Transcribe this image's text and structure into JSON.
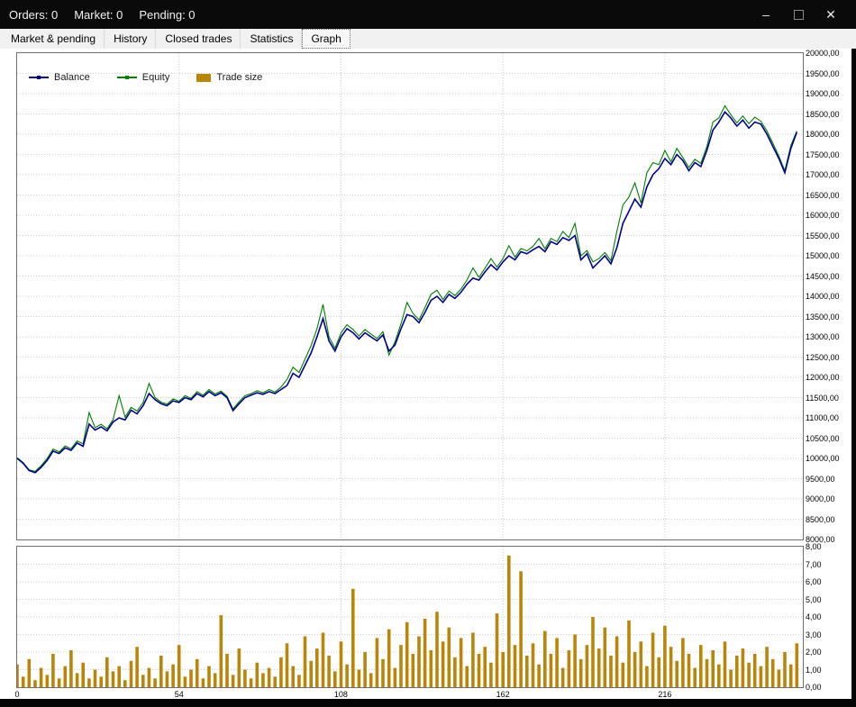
{
  "titlebar": {
    "orders": "Orders: 0",
    "market": "Market: 0",
    "pending": "Pending: 0",
    "minimize_glyph": "–",
    "close_glyph": "✕"
  },
  "tabs": [
    {
      "label": "Market & pending",
      "active": false
    },
    {
      "label": "History",
      "active": false
    },
    {
      "label": "Closed trades",
      "active": false
    },
    {
      "label": "Statistics",
      "active": false
    },
    {
      "label": "Graph",
      "active": true
    }
  ],
  "legend": [
    {
      "label": "Balance",
      "type": "line",
      "color": "#00008b"
    },
    {
      "label": "Equity",
      "type": "line",
      "color": "#008000"
    },
    {
      "label": "Trade size",
      "type": "swatch",
      "color": "#b8860b"
    }
  ],
  "chart_data": [
    {
      "type": "line",
      "ylim": [
        8000,
        20000
      ],
      "ytick_step": 500,
      "xlim": [
        0,
        262
      ],
      "xticks": [
        0,
        54,
        108,
        162,
        216
      ],
      "x_start": 0,
      "x_step": 2,
      "grid": true,
      "legend_position": "top-left",
      "decimal_separator": ",",
      "series": [
        {
          "name": "Balance",
          "color": "#00008b",
          "values": [
            10000,
            9880,
            9700,
            9650,
            9780,
            9950,
            10180,
            10120,
            10260,
            10200,
            10380,
            10300,
            10850,
            10700,
            10780,
            10680,
            10900,
            11000,
            10950,
            11190,
            11100,
            11300,
            11600,
            11450,
            11350,
            11300,
            11420,
            11380,
            11500,
            11450,
            11600,
            11520,
            11650,
            11550,
            11620,
            11500,
            11180,
            11350,
            11500,
            11560,
            11620,
            11580,
            11650,
            11600,
            11700,
            11800,
            12100,
            12000,
            12300,
            12600,
            13000,
            13450,
            12900,
            12650,
            13000,
            13200,
            13100,
            12950,
            13100,
            13000,
            12900,
            13050,
            12650,
            12800,
            13200,
            13550,
            13500,
            13350,
            13600,
            13900,
            14000,
            13850,
            14050,
            13950,
            14100,
            14300,
            14450,
            14400,
            14600,
            14780,
            14650,
            14850,
            15000,
            14900,
            15100,
            15050,
            15150,
            15230,
            15100,
            15350,
            15280,
            15450,
            15380,
            15500,
            14900,
            15050,
            14700,
            14850,
            15000,
            14800,
            15200,
            15800,
            16100,
            16400,
            16200,
            16700,
            17000,
            17150,
            17400,
            17250,
            17500,
            17350,
            17100,
            17300,
            17200,
            17600,
            18100,
            18300,
            18550,
            18400,
            18200,
            18350,
            18150,
            18300,
            18250,
            18000,
            17700,
            17400,
            17050,
            17650,
            18050
          ]
        },
        {
          "name": "Equity",
          "color": "#008000",
          "values": [
            10020,
            9900,
            9720,
            9680,
            9820,
            10000,
            10230,
            10160,
            10310,
            10240,
            10430,
            10360,
            11130,
            10760,
            10840,
            10730,
            10960,
            11550,
            11020,
            11260,
            11170,
            11380,
            11850,
            11500,
            11390,
            11340,
            11470,
            11410,
            11550,
            11480,
            11650,
            11560,
            11700,
            11590,
            11660,
            11530,
            11220,
            11400,
            11550,
            11600,
            11670,
            11620,
            11700,
            11640,
            11760,
            11950,
            12250,
            12120,
            12450,
            12780,
            13200,
            13800,
            13000,
            12720,
            13100,
            13300,
            13180,
            13020,
            13180,
            13070,
            12960,
            13130,
            12550,
            12880,
            13320,
            13850,
            13580,
            13420,
            13720,
            14050,
            14150,
            13920,
            14130,
            14020,
            14180,
            14400,
            14700,
            14470,
            14690,
            14930,
            14720,
            14930,
            15250,
            14970,
            15180,
            15120,
            15230,
            15430,
            15170,
            15430,
            15350,
            15600,
            15450,
            15800,
            15000,
            15130,
            14850,
            14930,
            15080,
            14880,
            15600,
            16250,
            16450,
            16800,
            16300,
            17050,
            17300,
            17250,
            17600,
            17320,
            17650,
            17420,
            17180,
            17380,
            17280,
            17700,
            18300,
            18400,
            18700,
            18480,
            18280,
            18450,
            18260,
            18420,
            18320,
            18080,
            17780,
            17460,
            17100,
            17720,
            18080
          ]
        }
      ]
    },
    {
      "type": "bar",
      "name": "Trade size",
      "color": "#b8860b",
      "ylim": [
        0,
        8
      ],
      "ytick_step": 1,
      "xlim": [
        0,
        262
      ],
      "xticks": [
        0,
        54,
        108,
        162,
        216
      ],
      "x_start": 0,
      "x_step": 2,
      "values": [
        1.3,
        0.6,
        1.6,
        0.4,
        1.1,
        0.7,
        1.9,
        0.5,
        1.2,
        2.1,
        0.8,
        1.4,
        0.5,
        1.0,
        0.6,
        1.7,
        0.9,
        1.2,
        0.4,
        1.5,
        2.3,
        0.7,
        1.1,
        0.5,
        1.8,
        0.9,
        1.3,
        2.4,
        0.6,
        1.0,
        1.6,
        0.5,
        1.2,
        0.8,
        4.1,
        1.9,
        0.7,
        2.2,
        1.0,
        0.5,
        1.4,
        0.8,
        1.1,
        0.6,
        1.7,
        2.5,
        1.2,
        0.7,
        2.9,
        1.5,
        2.2,
        3.1,
        1.8,
        0.9,
        2.6,
        1.3,
        5.6,
        1.0,
        2.0,
        0.8,
        2.8,
        1.6,
        3.3,
        1.1,
        2.4,
        3.7,
        1.9,
        2.9,
        3.9,
        2.1,
        4.3,
        2.6,
        3.4,
        1.7,
        2.8,
        1.2,
        3.1,
        1.9,
        2.3,
        1.4,
        4.2,
        2.0,
        7.5,
        2.4,
        6.6,
        1.8,
        2.5,
        1.3,
        3.2,
        1.9,
        2.8,
        1.1,
        2.1,
        3.0,
        1.6,
        2.4,
        4.0,
        2.2,
        3.4,
        1.8,
        2.9,
        1.4,
        3.8,
        2.0,
        2.6,
        1.2,
        3.1,
        1.7,
        3.5,
        2.3,
        1.5,
        2.8,
        1.9,
        1.1,
        2.4,
        1.6,
        2.1,
        1.3,
        2.6,
        1.0,
        1.8,
        2.2,
        1.4,
        1.9,
        1.2,
        2.3,
        1.6,
        1.0,
        2.0,
        1.3,
        2.5
      ]
    }
  ]
}
